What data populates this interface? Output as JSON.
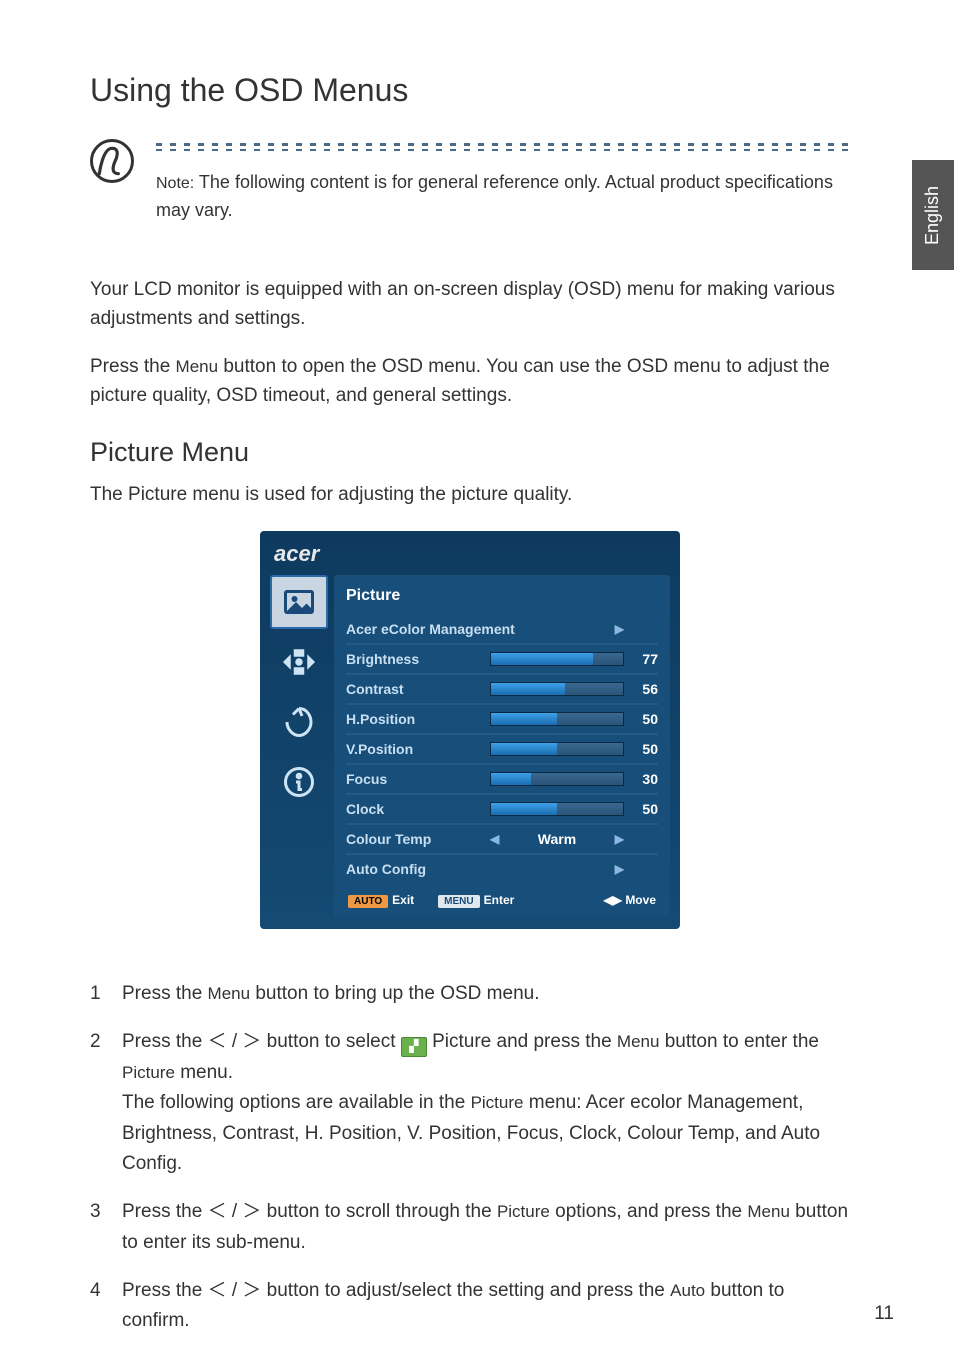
{
  "side_tab": "English",
  "heading": "Using the OSD Menus",
  "note": {
    "label": "Note:",
    "text": " The following content is for general reference only. Actual product specifications may vary."
  },
  "intro1": "Your LCD monitor is equipped with an on-screen display (OSD) menu for making various adjustments and settings.",
  "intro2_a": "Press the ",
  "intro2_menu": "Menu",
  "intro2_b": " button to open the OSD menu. You can use the OSD menu to adjust the picture quality, OSD timeout, and general settings.",
  "section_heading": "Picture Menu",
  "section_desc": "The Picture menu is used for adjusting the picture quality.",
  "osd": {
    "brand": "acer",
    "title": "Picture",
    "rows": [
      {
        "label": "Acer eColor Management",
        "type": "sub"
      },
      {
        "label": "Brightness",
        "type": "bar",
        "value": 77
      },
      {
        "label": "Contrast",
        "type": "bar",
        "value": 56
      },
      {
        "label": "H.Position",
        "type": "bar",
        "value": 50
      },
      {
        "label": "V.Position",
        "type": "bar",
        "value": 50
      },
      {
        "label": "Focus",
        "type": "bar",
        "value": 30
      },
      {
        "label": "Clock",
        "type": "bar",
        "value": 50
      },
      {
        "label": "Colour Temp",
        "type": "sel",
        "sel": "Warm"
      },
      {
        "label": "Auto Config",
        "type": "sub"
      }
    ],
    "footer": {
      "exit_btn": "AUTO",
      "exit": "Exit",
      "enter_btn": "MENU",
      "enter": "Enter",
      "move": "Move"
    },
    "nav_icons": [
      "picture-icon",
      "adjust-icon",
      "eco-icon",
      "info-icon"
    ]
  },
  "steps": {
    "s1_a": "Press the ",
    "s1_menu": "Menu",
    "s1_b": " button to bring up the OSD menu.",
    "s2_a": "Press the ",
    "s2_sym": "＜ / ＞",
    "s2_b": " button to select ",
    "s2_c": " Picture and press the ",
    "s2_menu": "Menu",
    "s2_d": " button to enter the ",
    "s2_pic": "Picture",
    "s2_e": " menu.",
    "s2_f": "The following options are available in the ",
    "s2_g": " menu: Acer ecolor Management, Brightness, Contrast, H. Position, V. Position, Focus, Clock, Colour Temp, and Auto Config.",
    "s3_a": "Press the ",
    "s3_sym": "＜ / ＞",
    "s3_b": " button to scroll through the ",
    "s3_pic": "Picture",
    "s3_c": " options, and press the ",
    "s3_menu": "Menu",
    "s3_d": " button to enter its sub-menu.",
    "s4_a": "Press the ",
    "s4_sym": "＜ / ＞",
    "s4_b": " button to adjust/select the setting and press the ",
    "s4_auto": "Auto",
    "s4_c": " button to confirm."
  },
  "page_number": "11"
}
